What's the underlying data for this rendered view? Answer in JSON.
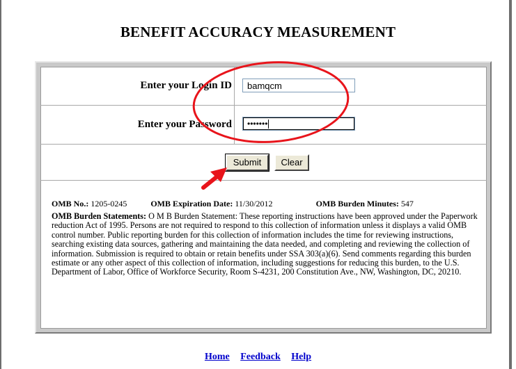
{
  "page": {
    "title": "BENEFIT ACCURACY MEASUREMENT"
  },
  "login": {
    "login_id_label": "Enter your Login ID",
    "login_id_value": "bamqcm",
    "password_label": "Enter your Password",
    "password_value": "•••••••",
    "submit_label": "Submit",
    "clear_label": "Clear"
  },
  "omb": {
    "number_label": "OMB No.:",
    "number_value": "1205-0245",
    "expiration_label": "OMB Expiration Date:",
    "expiration_value": "11/30/2012",
    "burden_minutes_label": "OMB Burden Minutes:",
    "burden_minutes_value": "547",
    "statement_label": "OMB Burden Statements:",
    "statement_text": "O M B Burden Statement: These reporting instructions have been approved under the Paperwork reduction Act of 1995. Persons are not required to respond to this collection of information unless it displays a valid OMB control number. Public reporting burden for this collection of information includes the time for reviewing instructions, searching existing data sources, gathering and maintaining the data needed, and completing and reviewing the collection of information. Submission is required to obtain or retain benefits under SSA 303(a)(6). Send comments regarding this burden estimate or any other aspect of this collection of information, including suggestions for reducing this burden, to the U.S. Department of Labor, Office of Workforce Security, Room S-4231, 200 Constitution Ave., NW, Washington, DC, 20210."
  },
  "footer": {
    "links": [
      "Home",
      "Feedback",
      "Help"
    ]
  },
  "colors": {
    "annotation": "#e8141b",
    "link": "#0000cc",
    "panel": "#c9c9c9"
  },
  "icons": {
    "annotation_ellipse": "highlight-ellipse",
    "annotation_arrow": "pointer-arrow-icon"
  }
}
